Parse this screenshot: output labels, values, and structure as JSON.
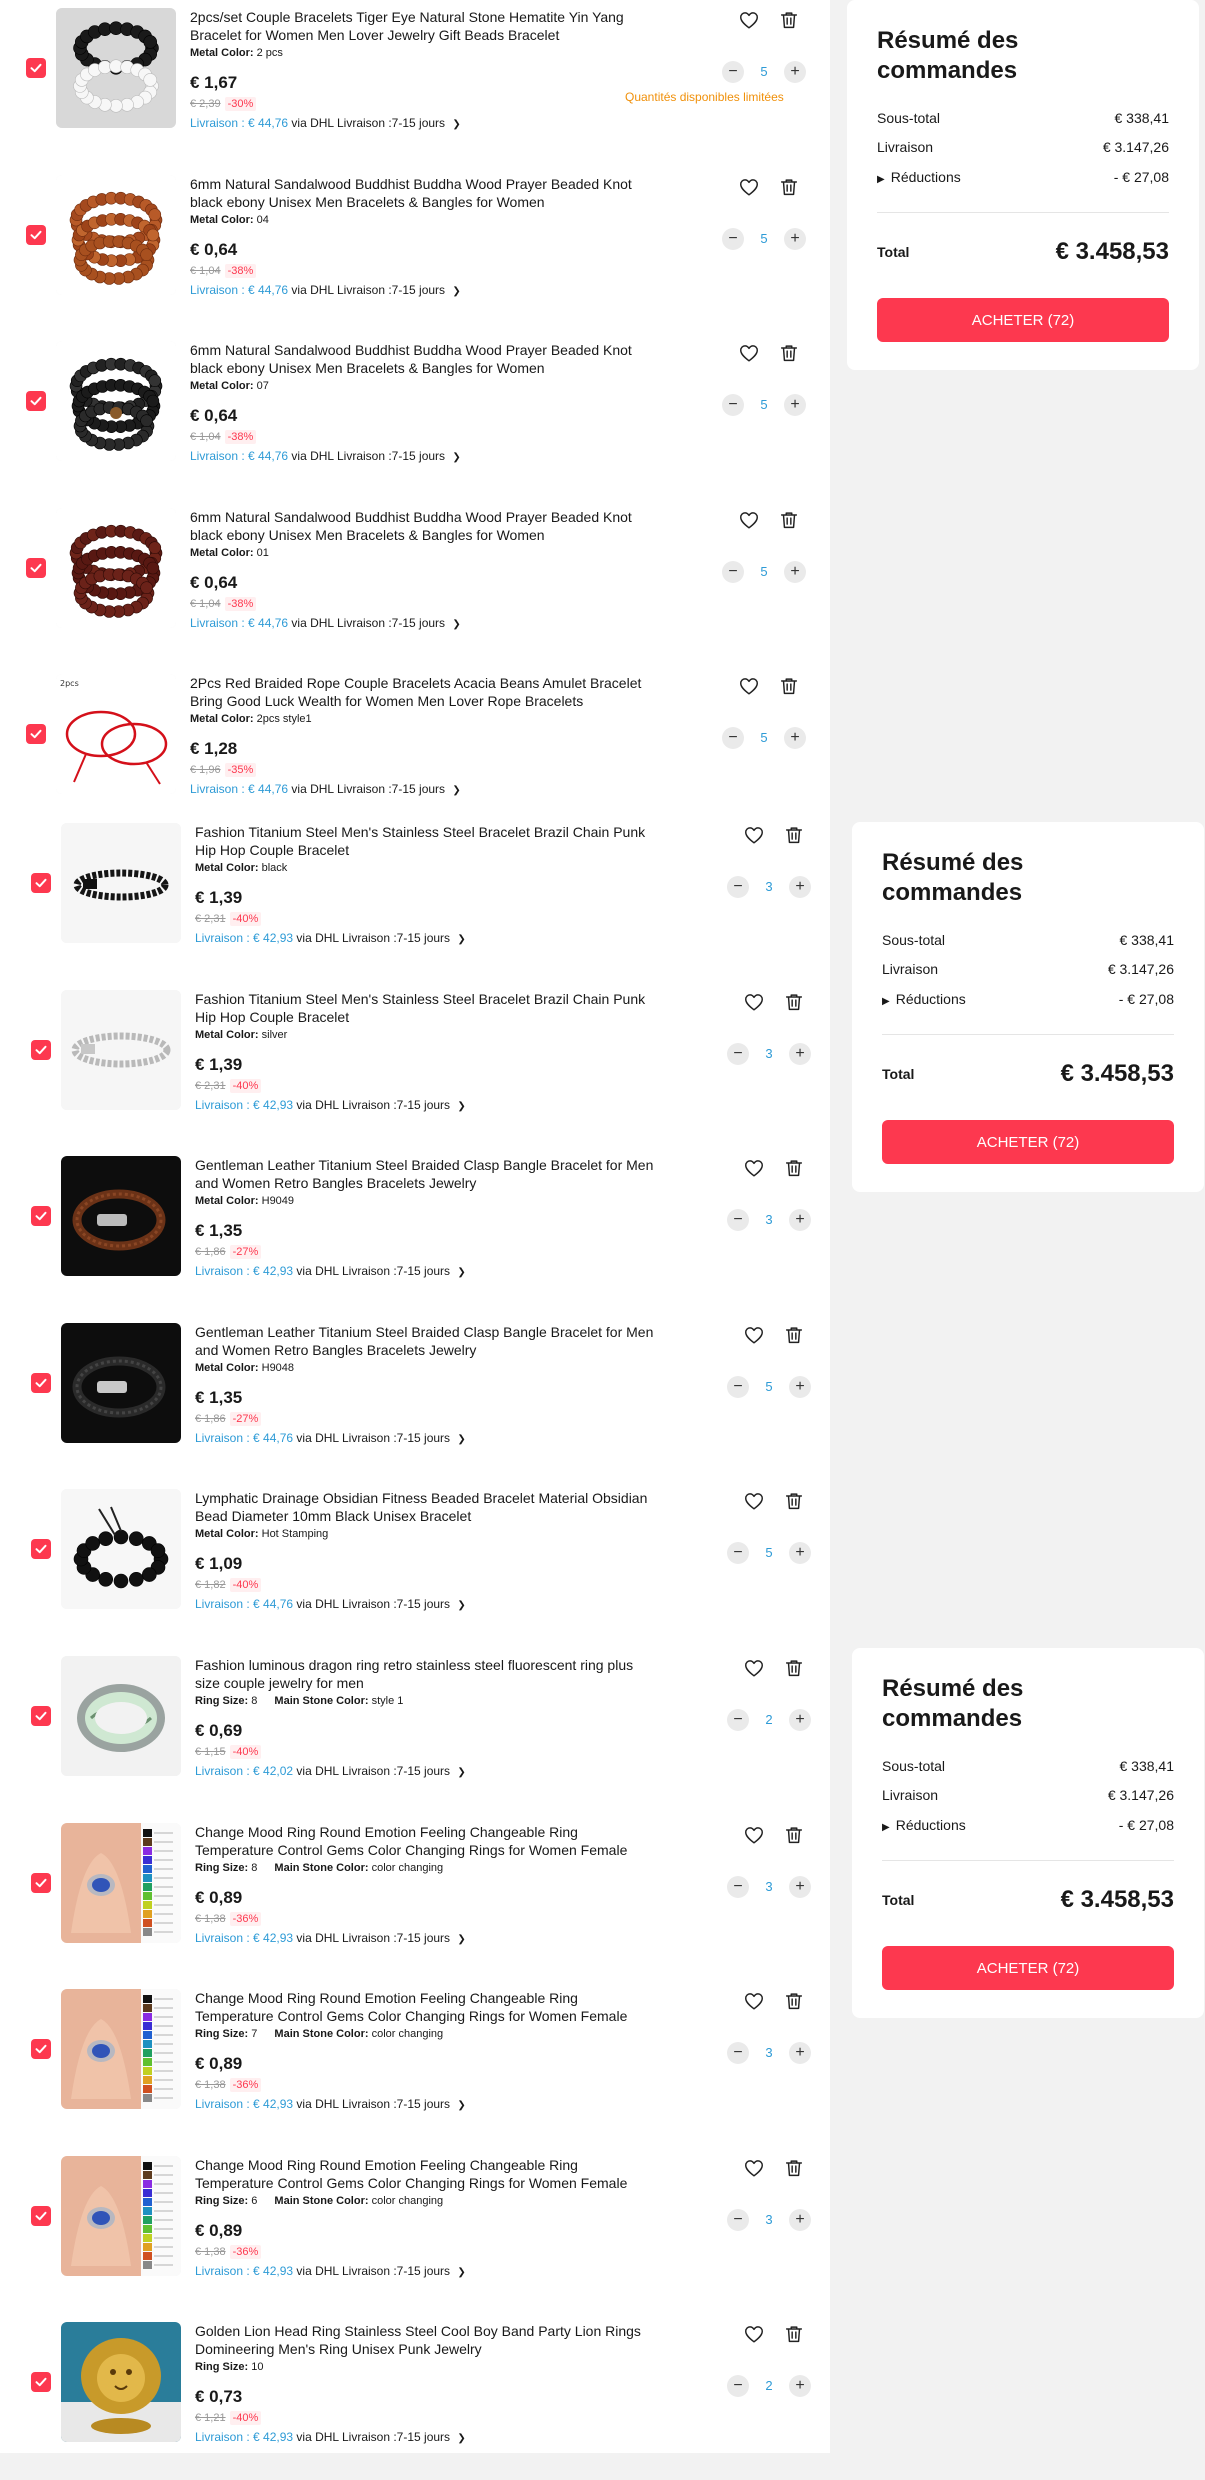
{
  "summary": {
    "title": "Résumé des commandes",
    "subtotal_label": "Sous-total",
    "subtotal_value": "€ 338,41",
    "shipping_label": "Livraison",
    "shipping_value": "€ 3.147,26",
    "discounts_label": "Réductions",
    "discounts_value": "- € 27,08",
    "total_label": "Total",
    "total_value": "€ 3.458,53",
    "buy_label": "ACHETER (72)"
  },
  "limited_stock_notice": "Quantités disponibles limitées",
  "items": [
    {
      "title": "2pcs/set Couple Bracelets Tiger Eye Natural Stone Hematite Yin Yang Bracelet for Women Men Lover Jewelry Gift Beads Bracelet",
      "attr1_label": "Metal Color:",
      "attr1_value": "2 pcs",
      "attr2_label": "",
      "attr2_value": "",
      "price": "€ 1,67",
      "orig_price": "€ 2,39",
      "discount": "-30%",
      "ship_fee": "Livraison : € 44,76",
      "ship_via": "via DHL",
      "ship_time": "Livraison :7-15 jours",
      "qty": "5",
      "image": "yin-yang-beads"
    },
    {
      "title": "6mm Natural Sandalwood Buddhist Buddha Wood Prayer Beaded Knot black ebony Unisex Men Bracelets & Bangles for Women",
      "attr1_label": "Metal Color:",
      "attr1_value": "04",
      "attr2_label": "",
      "attr2_value": "",
      "price": "€ 0,64",
      "orig_price": "€ 1,04",
      "discount": "-38%",
      "ship_fee": "Livraison : € 44,76",
      "ship_via": "via DHL",
      "ship_time": "Livraison :7-15 jours",
      "qty": "5",
      "image": "brown-wood-beads"
    },
    {
      "title": "6mm Natural Sandalwood Buddhist Buddha Wood Prayer Beaded Knot black ebony Unisex Men Bracelets & Bangles for Women",
      "attr1_label": "Metal Color:",
      "attr1_value": "07",
      "attr2_label": "",
      "attr2_value": "",
      "price": "€ 0,64",
      "orig_price": "€ 1,04",
      "discount": "-38%",
      "ship_fee": "Livraison : € 44,76",
      "ship_via": "via DHL",
      "ship_time": "Livraison :7-15 jours",
      "qty": "5",
      "image": "black-wood-beads"
    },
    {
      "title": "6mm Natural Sandalwood Buddhist Buddha Wood Prayer Beaded Knot black ebony Unisex Men Bracelets & Bangles for Women",
      "attr1_label": "Metal Color:",
      "attr1_value": "01",
      "attr2_label": "",
      "attr2_value": "",
      "price": "€ 0,64",
      "orig_price": "€ 1,04",
      "discount": "-38%",
      "ship_fee": "Livraison : € 44,76",
      "ship_via": "via DHL",
      "ship_time": "Livraison :7-15 jours",
      "qty": "5",
      "image": "red-wood-beads"
    },
    {
      "title": "2Pcs Red Braided Rope Couple Bracelets Acacia Beans Amulet Bracelet Bring Good Luck Wealth for Women Men Lover Rope Bracelets",
      "attr1_label": "Metal Color:",
      "attr1_value": "2pcs style1",
      "attr2_label": "",
      "attr2_value": "",
      "price": "€ 1,28",
      "orig_price": "€ 1,96",
      "discount": "-35%",
      "ship_fee": "Livraison : € 44,76",
      "ship_via": "via DHL",
      "ship_time": "Livraison :7-15 jours",
      "qty": "5",
      "image": "red-rope",
      "image_text": "2pcs"
    },
    {
      "title": "Fashion Titanium Steel Men's Stainless Steel Bracelet Brazil Chain Punk Hip Hop Couple Bracelet",
      "attr1_label": "Metal Color:",
      "attr1_value": "black",
      "attr2_label": "",
      "attr2_value": "",
      "price": "€ 1,39",
      "orig_price": "€ 2,31",
      "discount": "-40%",
      "ship_fee": "Livraison : € 42,93",
      "ship_via": "via DHL",
      "ship_time": "Livraison :7-15 jours",
      "qty": "3",
      "image": "black-chain"
    },
    {
      "title": "Fashion Titanium Steel Men's Stainless Steel Bracelet Brazil Chain Punk Hip Hop Couple Bracelet",
      "attr1_label": "Metal Color:",
      "attr1_value": "silver",
      "attr2_label": "",
      "attr2_value": "",
      "price": "€ 1,39",
      "orig_price": "€ 2,31",
      "discount": "-40%",
      "ship_fee": "Livraison : € 42,93",
      "ship_via": "via DHL",
      "ship_time": "Livraison :7-15 jours",
      "qty": "3",
      "image": "silver-chain"
    },
    {
      "title": "Gentleman Leather Titanium Steel Braided Clasp Bangle Bracelet for Men and Women Retro Bangles Bracelets Jewelry",
      "attr1_label": "Metal Color:",
      "attr1_value": "H9049",
      "attr2_label": "",
      "attr2_value": "",
      "price": "€ 1,35",
      "orig_price": "€ 1,86",
      "discount": "-27%",
      "ship_fee": "Livraison : € 42,93",
      "ship_via": "via DHL",
      "ship_time": "Livraison :7-15 jours",
      "qty": "3",
      "image": "brown-leather"
    },
    {
      "title": "Gentleman Leather Titanium Steel Braided Clasp Bangle Bracelet for Men and Women Retro Bangles Bracelets Jewelry",
      "attr1_label": "Metal Color:",
      "attr1_value": "H9048",
      "attr2_label": "",
      "attr2_value": "",
      "price": "€ 1,35",
      "orig_price": "€ 1,86",
      "discount": "-27%",
      "ship_fee": "Livraison : € 44,76",
      "ship_via": "via DHL",
      "ship_time": "Livraison :7-15 jours",
      "qty": "5",
      "image": "black-leather"
    },
    {
      "title": "Lymphatic Drainage Obsidian Fitness Beaded Bracelet Material Obsidian Bead Diameter 10mm Black Unisex Bracelet",
      "attr1_label": "Metal Color:",
      "attr1_value": "Hot Stamping",
      "attr2_label": "",
      "attr2_value": "",
      "price": "€ 1,09",
      "orig_price": "€ 1,82",
      "discount": "-40%",
      "ship_fee": "Livraison : € 44,76",
      "ship_via": "via DHL",
      "ship_time": "Livraison :7-15 jours",
      "qty": "5",
      "image": "obsidian-beads"
    },
    {
      "title": "Fashion luminous dragon ring retro stainless steel fluorescent ring plus size couple jewelry for men",
      "attr1_label": "Ring Size:",
      "attr1_value": "8",
      "attr2_label": "Main Stone Color:",
      "attr2_value": "style 1",
      "price": "€ 0,69",
      "orig_price": "€ 1,15",
      "discount": "-40%",
      "ship_fee": "Livraison : € 42,02",
      "ship_via": "via DHL",
      "ship_time": "Livraison :7-15 jours",
      "qty": "2",
      "image": "dragon-ring"
    },
    {
      "title": "Change Mood Ring Round Emotion Feeling Changeable Ring Temperature Control Gems Color Changing Rings for Women Female",
      "attr1_label": "Ring Size:",
      "attr1_value": "8",
      "attr2_label": "Main Stone Color:",
      "attr2_value": "color changing",
      "price": "€ 0,89",
      "orig_price": "€ 1,38",
      "discount": "-36%",
      "ship_fee": "Livraison : € 42,93",
      "ship_via": "via DHL",
      "ship_time": "Livraison :7-15 jours",
      "qty": "3",
      "image": "mood-ring"
    },
    {
      "title": "Change Mood Ring Round Emotion Feeling Changeable Ring Temperature Control Gems Color Changing Rings for Women Female",
      "attr1_label": "Ring Size:",
      "attr1_value": "7",
      "attr2_label": "Main Stone Color:",
      "attr2_value": "color changing",
      "price": "€ 0,89",
      "orig_price": "€ 1,38",
      "discount": "-36%",
      "ship_fee": "Livraison : € 42,93",
      "ship_via": "via DHL",
      "ship_time": "Livraison :7-15 jours",
      "qty": "3",
      "image": "mood-ring"
    },
    {
      "title": "Change Mood Ring Round Emotion Feeling Changeable Ring Temperature Control Gems Color Changing Rings for Women Female",
      "attr1_label": "Ring Size:",
      "attr1_value": "6",
      "attr2_label": "Main Stone Color:",
      "attr2_value": "color changing",
      "price": "€ 0,89",
      "orig_price": "€ 1,38",
      "discount": "-36%",
      "ship_fee": "Livraison : € 42,93",
      "ship_via": "via DHL",
      "ship_time": "Livraison :7-15 jours",
      "qty": "3",
      "image": "mood-ring"
    },
    {
      "title": "Golden Lion Head Ring Stainless Steel Cool Boy Band Party Lion Rings Domineering Men's Ring Unisex Punk Jewelry",
      "attr1_label": "Ring Size:",
      "attr1_value": "10",
      "attr2_label": "",
      "attr2_value": "",
      "price": "€ 0,73",
      "orig_price": "€ 1,21",
      "discount": "-40%",
      "ship_fee": "Livraison : € 42,93",
      "ship_via": "via DHL",
      "ship_time": "Livraison :7-15 jours",
      "qty": "2",
      "image": "lion-ring"
    }
  ],
  "colors": {
    "accent": "#fd384f",
    "link": "#2e9bd6",
    "warning": "#f0900a"
  }
}
